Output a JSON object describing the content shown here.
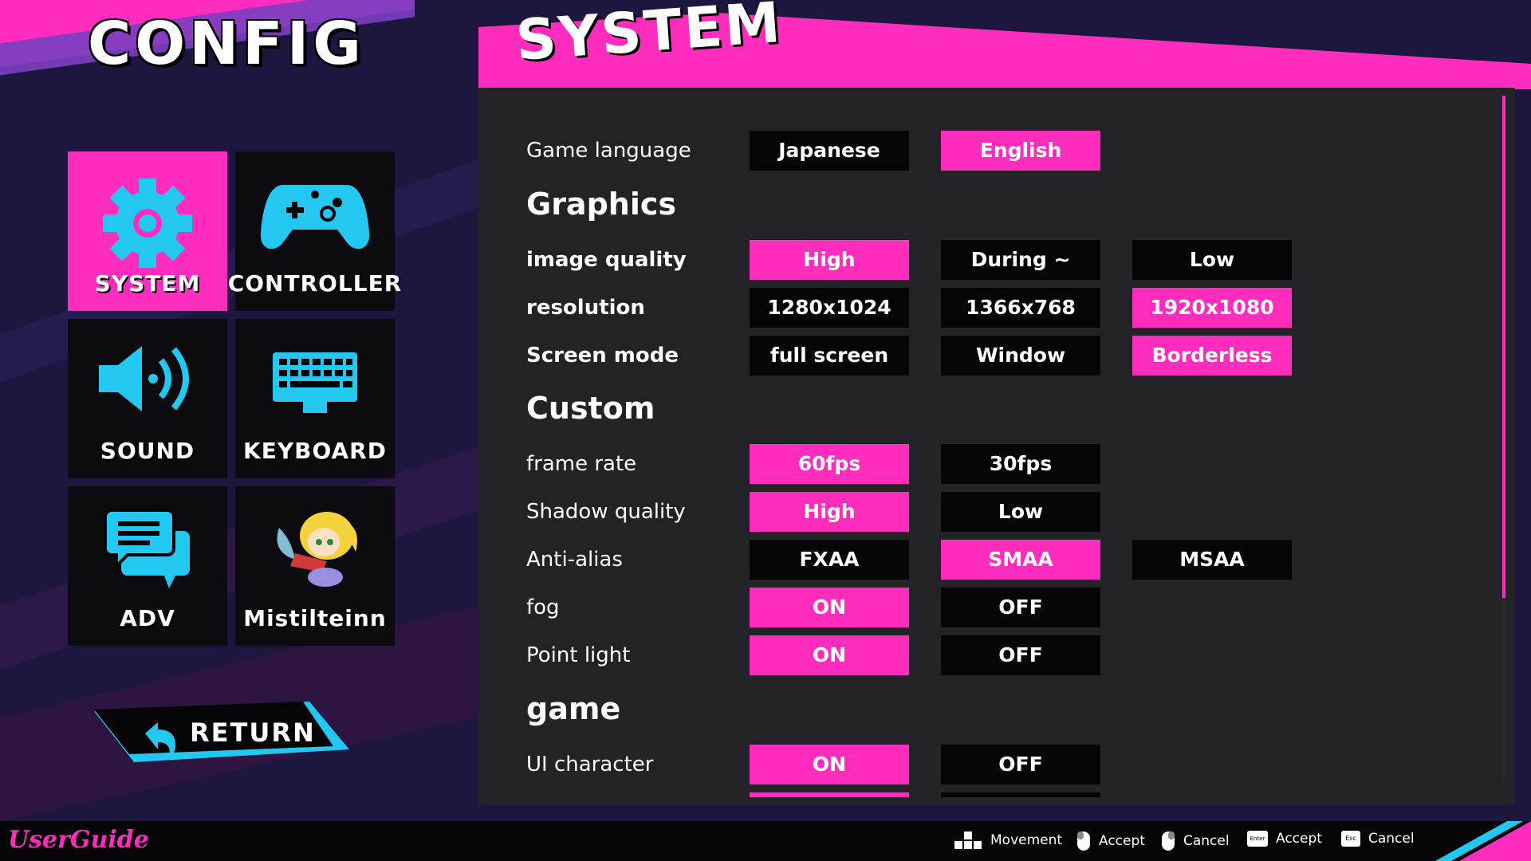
{
  "config": {
    "title": "CONFIG"
  },
  "menu": {
    "tiles": [
      {
        "label": "SYSTEM",
        "icon": "gear-icon",
        "active": true
      },
      {
        "label": "CONTROLLER",
        "icon": "gamepad-icon",
        "active": false
      },
      {
        "label": "SOUND",
        "icon": "speaker-icon",
        "active": false
      },
      {
        "label": "KEYBOARD",
        "icon": "keyboard-icon",
        "active": false
      },
      {
        "label": "ADV",
        "icon": "chat-bubbles-icon",
        "active": false
      },
      {
        "label": "Mistilteinn",
        "icon": "fairy-character-icon",
        "active": false
      }
    ],
    "return_label": "RETURN"
  },
  "panel": {
    "title": "SYSTEM",
    "game_language": {
      "label": "Game language",
      "options": [
        "Japanese",
        "English"
      ],
      "selected": 1
    },
    "graphics": {
      "heading": "Graphics",
      "image_quality": {
        "label": "image quality",
        "options": [
          "High",
          "During ~",
          "Low"
        ],
        "selected": 0
      },
      "resolution": {
        "label": "resolution",
        "options": [
          "1280x1024",
          "1366x768",
          "1920x1080"
        ],
        "selected": 2
      },
      "screen_mode": {
        "label": "Screen mode",
        "options": [
          "full screen",
          "Window",
          "Borderless"
        ],
        "selected": 2
      }
    },
    "custom": {
      "heading": "Custom",
      "frame_rate": {
        "label": "frame rate",
        "options": [
          "60fps",
          "30fps"
        ],
        "selected": 0
      },
      "shadow_quality": {
        "label": "Shadow quality",
        "options": [
          "High",
          "Low"
        ],
        "selected": 0
      },
      "anti_alias": {
        "label": "Anti-alias",
        "options": [
          "FXAA",
          "SMAA",
          "MSAA"
        ],
        "selected": 1
      },
      "fog": {
        "label": "fog",
        "options": [
          "ON",
          "OFF"
        ],
        "selected": 0
      },
      "point_light": {
        "label": "Point light",
        "options": [
          "ON",
          "OFF"
        ],
        "selected": 0
      }
    },
    "game": {
      "heading": "game",
      "ui_character": {
        "label": "UI character",
        "options": [
          "ON",
          "OFF"
        ],
        "selected": 0
      }
    }
  },
  "bottom_bar": {
    "logo": "UserGuide",
    "hints": [
      {
        "icon": "dpad-icon",
        "label": "Movement"
      },
      {
        "icon": "mouse-left-icon",
        "label": "Accept"
      },
      {
        "icon": "mouse-right-icon",
        "label": "Cancel"
      },
      {
        "icon": "enter-key-icon",
        "key": "Enter",
        "label": "Accept"
      },
      {
        "icon": "esc-key-icon",
        "key": "Esc",
        "label": "Cancel"
      }
    ]
  },
  "colors": {
    "accent": "#ff2dbd",
    "icon": "#22c8f0",
    "background": "#1d1740",
    "panel": "#232327",
    "button": "#050507"
  }
}
